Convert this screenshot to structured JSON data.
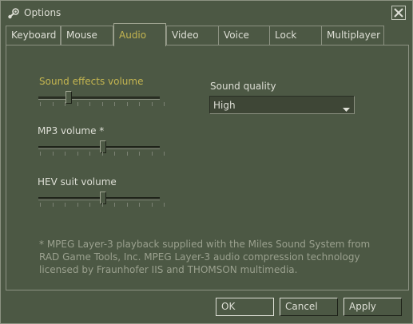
{
  "window": {
    "title": "Options",
    "icon": "steam-icon",
    "close_icon": "close-icon"
  },
  "tabs": [
    {
      "label": "Keyboard",
      "active": false
    },
    {
      "label": "Mouse",
      "active": false
    },
    {
      "label": "Audio",
      "active": true
    },
    {
      "label": "Video",
      "active": false
    },
    {
      "label": "Voice",
      "active": false
    },
    {
      "label": "Lock",
      "active": false
    },
    {
      "label": "Multiplayer",
      "active": false
    }
  ],
  "audio": {
    "sound_effects": {
      "label": "Sound effects volume",
      "level": 0.2
    },
    "mp3": {
      "label": "MP3 volume *",
      "level": 0.5
    },
    "hev": {
      "label": "HEV suit volume",
      "level": 0.5
    },
    "quality": {
      "label": "Sound quality",
      "value": "High"
    },
    "note": "* MPEG Layer-3 playback supplied with the Miles Sound System from RAD Game Tools, Inc. MPEG Layer-3 audio compression technology licensed by Fraunhofer IIS and THOMSON multimedia."
  },
  "buttons": {
    "ok": "OK",
    "cancel": "Cancel",
    "apply": "Apply"
  },
  "colors": {
    "background": "#4c5844",
    "highlight": "#c4b550",
    "text": "#dedfd6"
  }
}
